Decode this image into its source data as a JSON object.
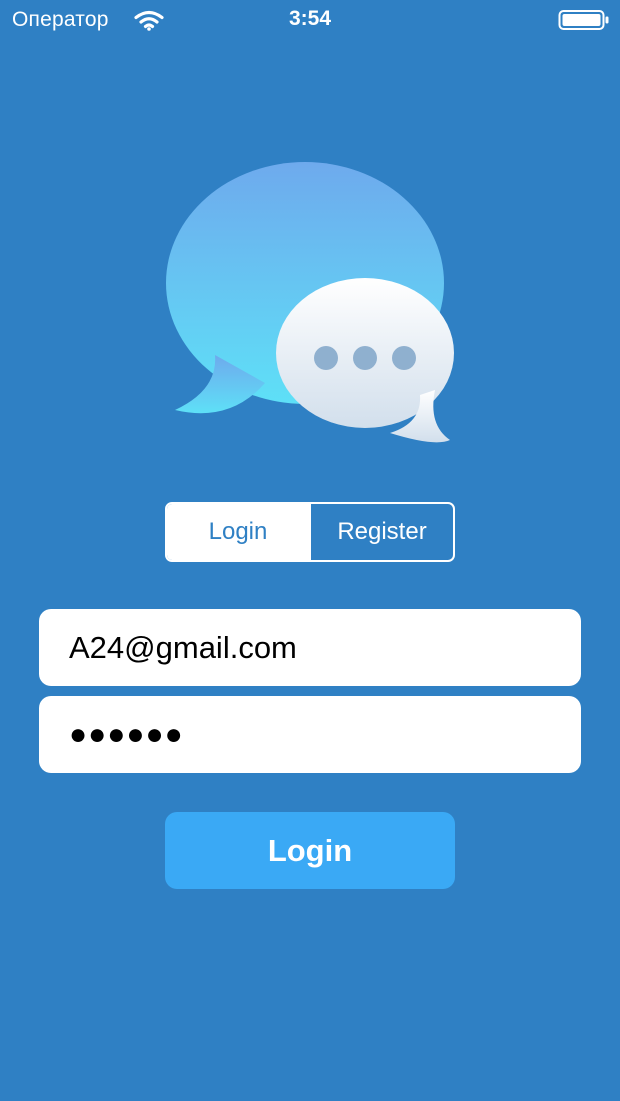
{
  "status_bar": {
    "carrier": "Оператор",
    "time": "3:54",
    "icons": [
      "wifi-icon",
      "battery-icon"
    ]
  },
  "logo": {
    "icon": "chat-bubbles-icon"
  },
  "segmented_control": {
    "login_label": "Login",
    "register_label": "Register",
    "selected": "Login"
  },
  "form": {
    "email_value": "A24@gmail.com",
    "password_value": "●●●●●●"
  },
  "login_button": {
    "label": "Login"
  },
  "colors": {
    "background": "#2f80c4",
    "button": "#3aa9f5",
    "field": "#ffffff"
  }
}
